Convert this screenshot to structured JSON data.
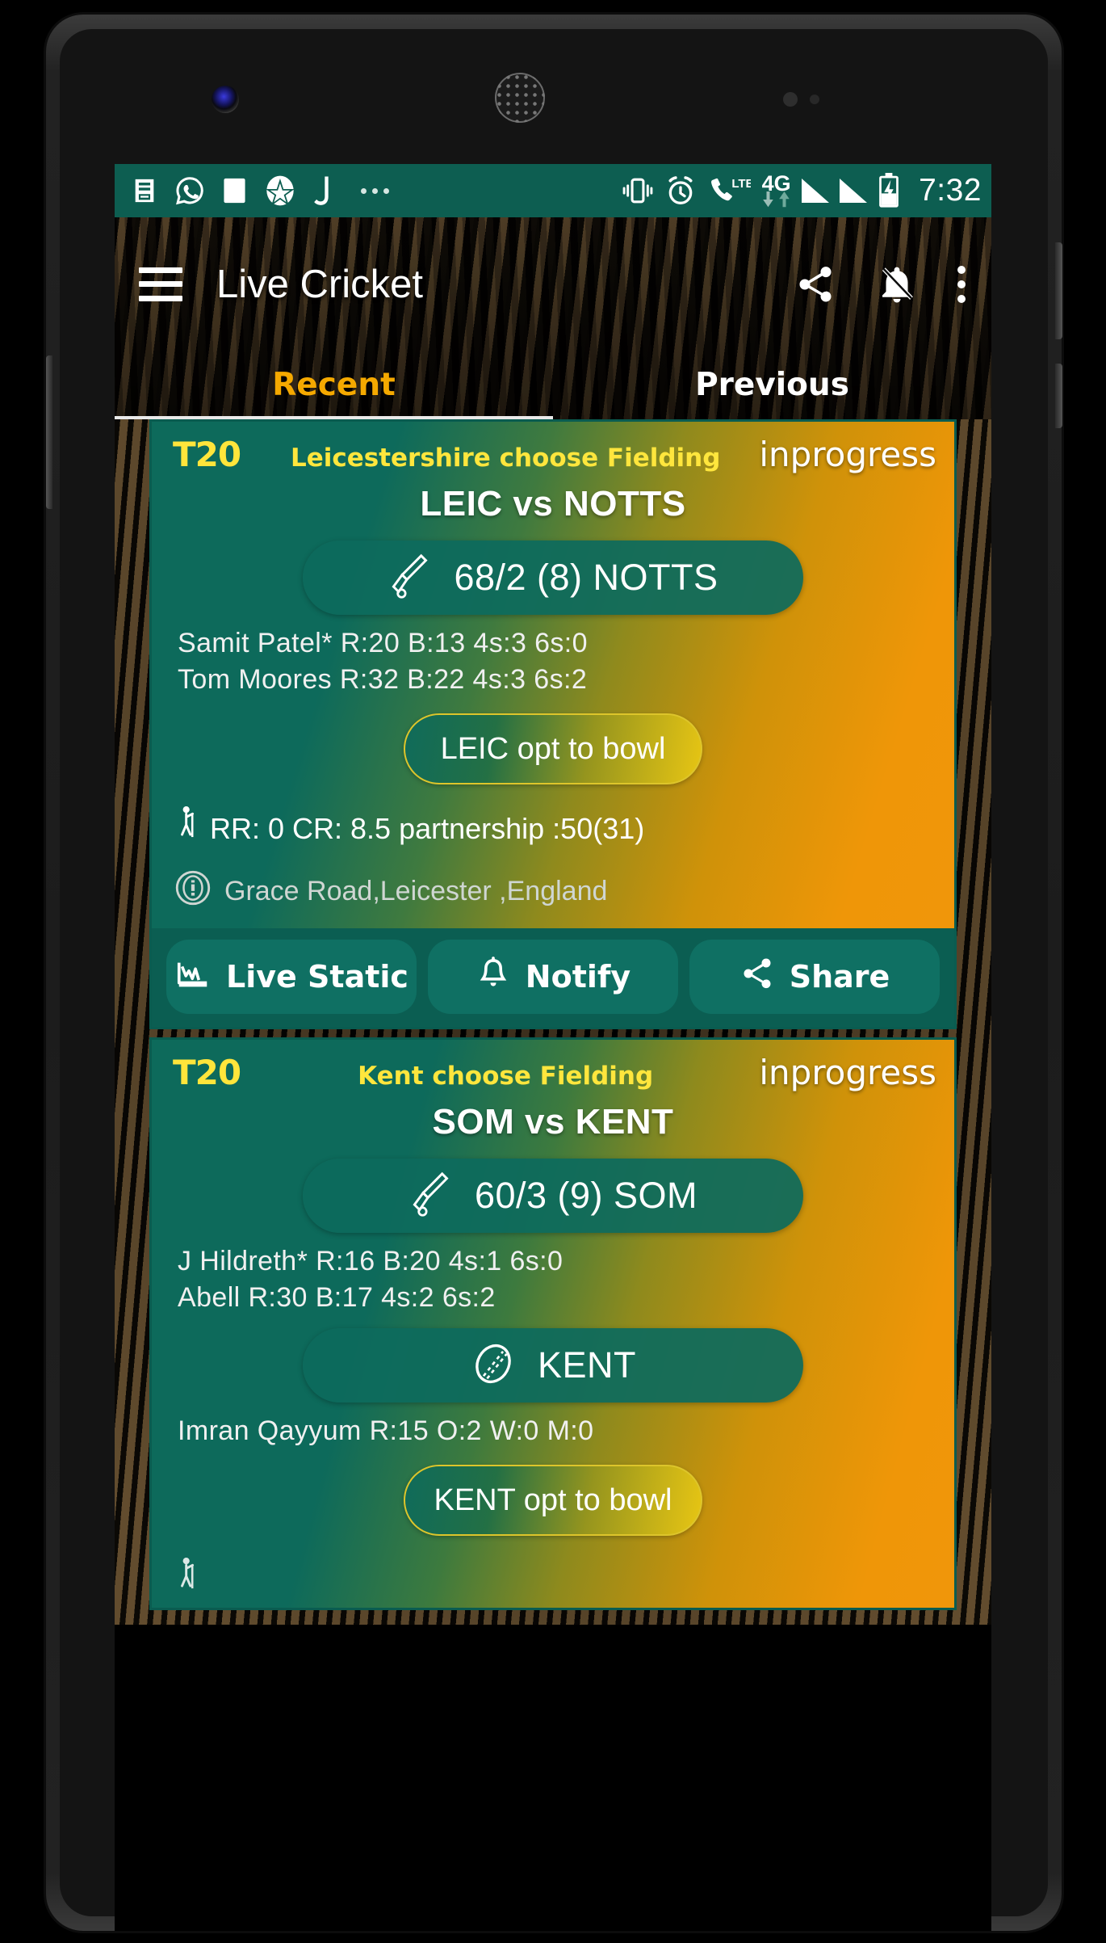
{
  "statusbar": {
    "icons": [
      "news-icon",
      "whatsapp-icon",
      "square-icon",
      "star-circle-icon",
      "j-letter-icon",
      "more-dots-icon",
      "vibrate-icon",
      "alarm-icon",
      "call-lte-icon"
    ],
    "lte_label": "LTE",
    "network_label": "4G",
    "time": "7:32"
  },
  "toolbar": {
    "menu_icon": "hamburger-icon",
    "title": "Live Cricket",
    "share_icon": "share-icon",
    "notifications_off_icon": "bell-off-icon",
    "overflow_icon": "kebab-menu-icon"
  },
  "tabs": [
    {
      "label": "Recent",
      "active": true
    },
    {
      "label": "Previous",
      "active": false
    }
  ],
  "matches": [
    {
      "format": "T20",
      "toss": "Leicestershire choose Fielding",
      "status": "inprogress",
      "teams": "LEIC vs NOTTS",
      "score_icon": "cricket-bat-icon",
      "score": "68/2 (8) NOTTS",
      "players": [
        "Samit Patel*  R:20  B:13  4s:3  6s:0",
        "Tom Moores  R:32  B:22  4s:3  6s:2"
      ],
      "opt_label": "LEIC opt to bowl",
      "rate_icon": "batsman-icon",
      "rate_line": "RR: 0 CR: 8.5 partnership :50(31)",
      "venue_icon": "stadium-icon",
      "venue": "Grace Road,Leicester ,England",
      "actions": [
        {
          "label": "Live Static",
          "icon": "chart-icon"
        },
        {
          "label": "Notify",
          "icon": "bell-icon"
        },
        {
          "label": "Share",
          "icon": "share-icon"
        }
      ]
    },
    {
      "format": "T20",
      "toss": "Kent choose Fielding",
      "status": "inprogress",
      "teams": "SOM vs KENT",
      "score_icon": "cricket-bat-icon",
      "score": "60/3 (9) SOM",
      "players": [
        "J Hildreth*  R:16  B:20  4s:1  6s:0",
        "Abell  R:30  B:17  4s:2  6s:2"
      ],
      "bowl_icon": "cricket-ball-icon",
      "bowl_team": "KENT",
      "bowlers": [
        "Imran Qayyum  R:15  O:2  W:0  M:0"
      ],
      "opt_label": "KENT opt to bowl"
    }
  ],
  "colors": {
    "status_bar": "#0d5e51",
    "accent_yellow": "#f5a900",
    "toss_yellow": "#ffe63d",
    "card_teal": "#0d6a5b",
    "card_orange": "#f0960a"
  }
}
